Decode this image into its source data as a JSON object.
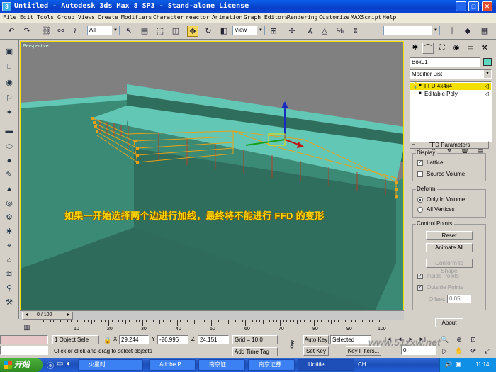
{
  "window": {
    "title": "Untitled - Autodesk 3ds Max 8 SP3  - Stand-alone License",
    "minimize": "_",
    "maximize": "□",
    "close": "✕"
  },
  "menu": [
    "File",
    "Edit",
    "Tools",
    "Group",
    "Views",
    "Create",
    "Modifiers",
    "Character",
    "reactor",
    "Animation",
    "Graph Editors",
    "Rendering",
    "Customize",
    "MAXScript",
    "Help"
  ],
  "toolbar": {
    "selection_filter": "All",
    "reference_coord": "View",
    "named_selection": ""
  },
  "viewport": {
    "label": "Perspective",
    "note": "如果一开始选择两个边进行加线，最终将不能进行 FFD 的变形",
    "colors": {
      "top": "#63c7b5",
      "face_dark": "#2f6e5c",
      "face_mid": "#3b8a75",
      "floor": "#2f6b5a",
      "lattice": "#e8a018",
      "seam": "#b3402a",
      "gizmo": "#1a2cc0"
    }
  },
  "timeline": {
    "frame_readout": "0 / 100",
    "ticks": [
      "10",
      "20",
      "30",
      "40",
      "50",
      "60",
      "70",
      "80",
      "90",
      "100"
    ]
  },
  "command_panel": {
    "object_name": "Box01",
    "modifier_list": "Modifier List",
    "stack": [
      {
        "label": "FFD 4x4x4",
        "selected": true
      },
      {
        "label": "Editable Poly",
        "selected": false
      }
    ],
    "rollout_title": "FFD Parameters",
    "display": {
      "label": "Display:",
      "lattice": "Lattice",
      "lattice_checked": true,
      "source_volume": "Source Volume",
      "source_volume_checked": false
    },
    "deform": {
      "label": "Deform:",
      "only_in_volume": "Only In Volume",
      "all_vertices": "All Vertices",
      "selected": "Only In Volume"
    },
    "control_points": {
      "label": "Control Points:",
      "reset": "Reset",
      "animate_all": "Animate All",
      "conform": "Conform to Shape",
      "inside_points": "Inside Points",
      "outside_points": "Outside Points",
      "offset_label": "Offset:",
      "offset_value": "0.05"
    },
    "about": "About"
  },
  "status": {
    "selection": "1 Object Sele",
    "x_label": "X",
    "x_value": "29.244",
    "y_label": "Y",
    "y_value": "-26.996",
    "z_label": "Z",
    "z_value": "24.151",
    "grid": "Grid = 10.0",
    "auto_key": "Auto Key",
    "selected": "Selected",
    "set_key": "Set Key",
    "key_filters": "Key Filters...",
    "frame": "0",
    "prompt": "Click or click-and-drag to select objects",
    "add_time_tag": "Add Time Tag",
    "watermark": "www.51zxw.net"
  },
  "taskbar": {
    "start": "开始",
    "tasks": [
      "火星时...",
      "Adobe P...",
      "南京证",
      "南京证券",
      "Untitle...",
      "CH"
    ],
    "clock": "11:14"
  }
}
